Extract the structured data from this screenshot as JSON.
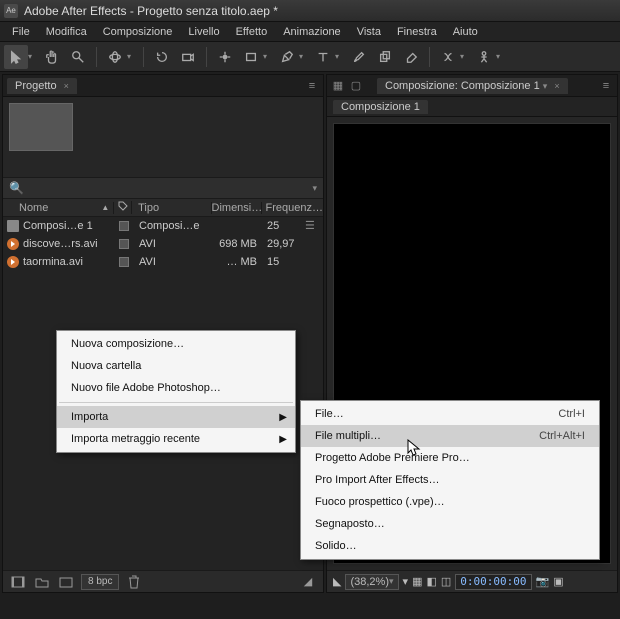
{
  "app": {
    "icon_text": "Ae",
    "title": "Adobe After Effects - Progetto senza titolo.aep *"
  },
  "menubar": [
    "File",
    "Modifica",
    "Composizione",
    "Livello",
    "Effetto",
    "Animazione",
    "Vista",
    "Finestra",
    "Aiuto"
  ],
  "project_panel": {
    "tab_label": "Progetto",
    "search_placeholder": "",
    "columns": {
      "name": "Nome",
      "tag_icon": "",
      "type": "Tipo",
      "dim": "Dimensi…",
      "freq": "Frequenz…"
    },
    "items": [
      {
        "icon": "comp",
        "name": "Composi…e 1",
        "type": "Composi…e",
        "dim": "",
        "freq": "25"
      },
      {
        "icon": "vid",
        "name": "discove…rs.avi",
        "type": "AVI",
        "dim": "698 MB",
        "freq": "29,97"
      },
      {
        "icon": "vid",
        "name": "taormina.avi",
        "type": "AVI",
        "dim": "… MB",
        "freq": "15"
      }
    ],
    "bpc_label": "8 bpc"
  },
  "comp_panel": {
    "tab_label": "Composizione: Composizione 1",
    "subtab_label": "Composizione 1",
    "zoom": "(38,2%)",
    "timecode": "0:00:00:00"
  },
  "context_menu": {
    "items": [
      {
        "label": "Nuova composizione…"
      },
      {
        "label": "Nuova cartella"
      },
      {
        "label": "Nuovo file Adobe Photoshop…"
      },
      {
        "divider": true
      },
      {
        "label": "Importa",
        "submenu": true,
        "highlight": true
      },
      {
        "label": "Importa metraggio recente",
        "submenu": true
      }
    ]
  },
  "import_submenu": {
    "items": [
      {
        "label": "File…",
        "shortcut": "Ctrl+I"
      },
      {
        "label": "File multipli…",
        "shortcut": "Ctrl+Alt+I",
        "highlight": true
      },
      {
        "label": "Progetto Adobe Premiere Pro…"
      },
      {
        "label": "Pro Import After Effects…"
      },
      {
        "label": "Fuoco prospettico (.vpe)…"
      },
      {
        "label": "Segnaposto…"
      },
      {
        "label": "Solido…"
      }
    ]
  }
}
